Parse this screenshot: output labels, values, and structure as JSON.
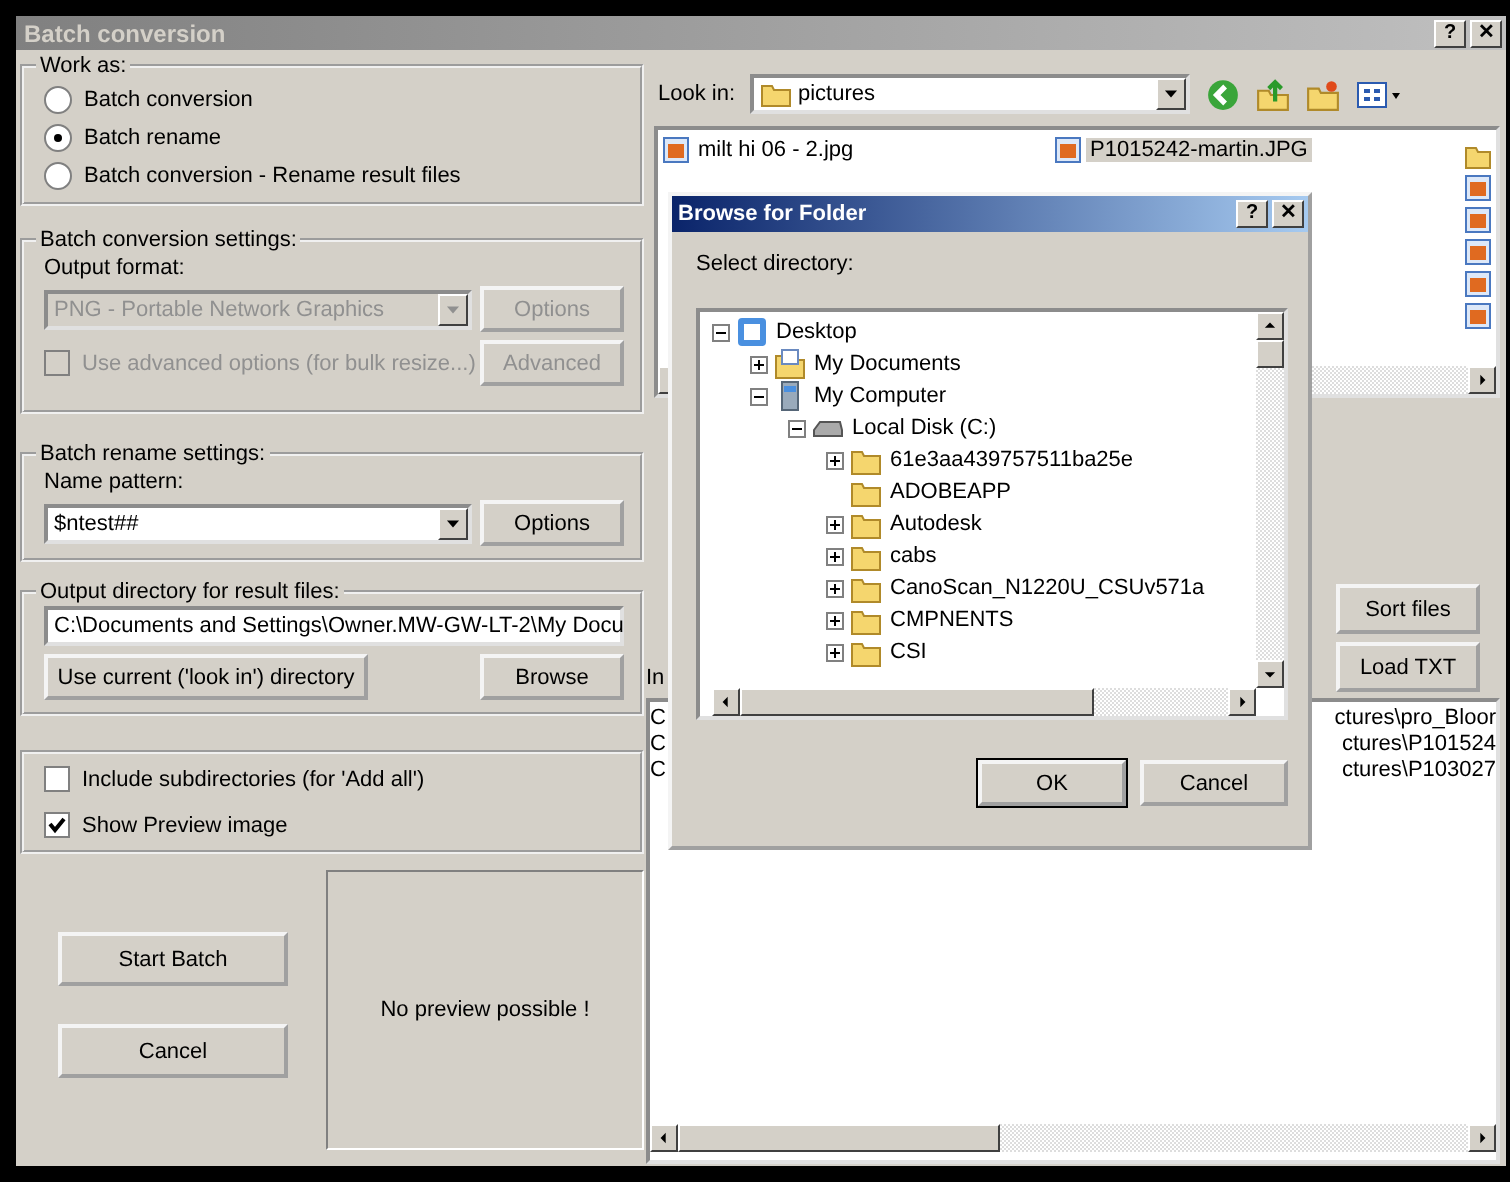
{
  "window": {
    "title": "Batch conversion",
    "help_button": "?",
    "close_button": "✕"
  },
  "work_as": {
    "title": "Work as:",
    "options": [
      {
        "label": "Batch conversion",
        "selected": false
      },
      {
        "label": "Batch rename",
        "selected": true
      },
      {
        "label": "Batch conversion - Rename result files",
        "selected": false
      }
    ]
  },
  "conversion_settings": {
    "title": "Batch conversion settings:",
    "format_label": "Output format:",
    "format_value": "PNG - Portable Network Graphics",
    "disabled": true,
    "options_button": "Options",
    "advanced_checkbox": {
      "label": "Use advanced options (for bulk resize...)",
      "checked": false,
      "disabled": true
    },
    "advanced_button": "Advanced"
  },
  "rename_settings": {
    "title": "Batch rename settings:",
    "pattern_label": "Name pattern:",
    "pattern_value": "$ntest##",
    "options_button": "Options"
  },
  "output_directory": {
    "title": "Output directory for result files:",
    "path": "C:\\Documents and Settings\\Owner.MW-GW-LT-2\\My Docu",
    "use_current_button": "Use current ('look in') directory",
    "browse_button": "Browse"
  },
  "checkboxes": [
    {
      "label": "Include subdirectories (for 'Add all')",
      "checked": false
    },
    {
      "label": "Show Preview image",
      "checked": true
    }
  ],
  "start_button": "Start Batch",
  "cancel_button": "Cancel",
  "preview_text": "No preview possible !",
  "look_in": {
    "label": "Look in:",
    "value": "pictures"
  },
  "files": [
    {
      "name": "milt hi 06 - 2.jpg",
      "selected": false
    },
    {
      "name": "P1015242-martin.JPG",
      "selected": true
    }
  ],
  "sort_button": "Sort files",
  "load_button": "Load TXT",
  "input_label": "In",
  "input_files": [
    {
      "start": "C",
      "end": "ctures\\pro_Bloor"
    },
    {
      "start": "C",
      "end": "ctures\\P101524"
    },
    {
      "start": "C",
      "end": "ctures\\P103027"
    }
  ],
  "dialog": {
    "title": "Browse for Folder",
    "help_button": "?",
    "close_button": "✕",
    "prompt": "Select directory:",
    "ok_button": "OK",
    "cancel_button": "Cancel",
    "tree": [
      {
        "label": "Desktop",
        "kind": "desktop",
        "expanded": true,
        "children": [
          {
            "label": "My Documents",
            "kind": "documents",
            "expanded": false
          },
          {
            "label": "My Computer",
            "kind": "computer",
            "expanded": true,
            "children": [
              {
                "label": "Local Disk (C:)",
                "kind": "drive",
                "expanded": true,
                "children": [
                  {
                    "label": "61e3aa439757511ba25e",
                    "kind": "folder",
                    "expanded": false
                  },
                  {
                    "label": "ADOBEAPP",
                    "kind": "folder"
                  },
                  {
                    "label": "Autodesk",
                    "kind": "folder",
                    "expanded": false
                  },
                  {
                    "label": "cabs",
                    "kind": "folder",
                    "expanded": false
                  },
                  {
                    "label": "CanoScan_N1220U_CSUv571a",
                    "kind": "folder",
                    "expanded": false
                  },
                  {
                    "label": "CMPNENTS",
                    "kind": "folder",
                    "expanded": false
                  },
                  {
                    "label": "CSI",
                    "kind": "folder",
                    "expanded": false
                  }
                ]
              }
            ]
          }
        ]
      }
    ]
  }
}
